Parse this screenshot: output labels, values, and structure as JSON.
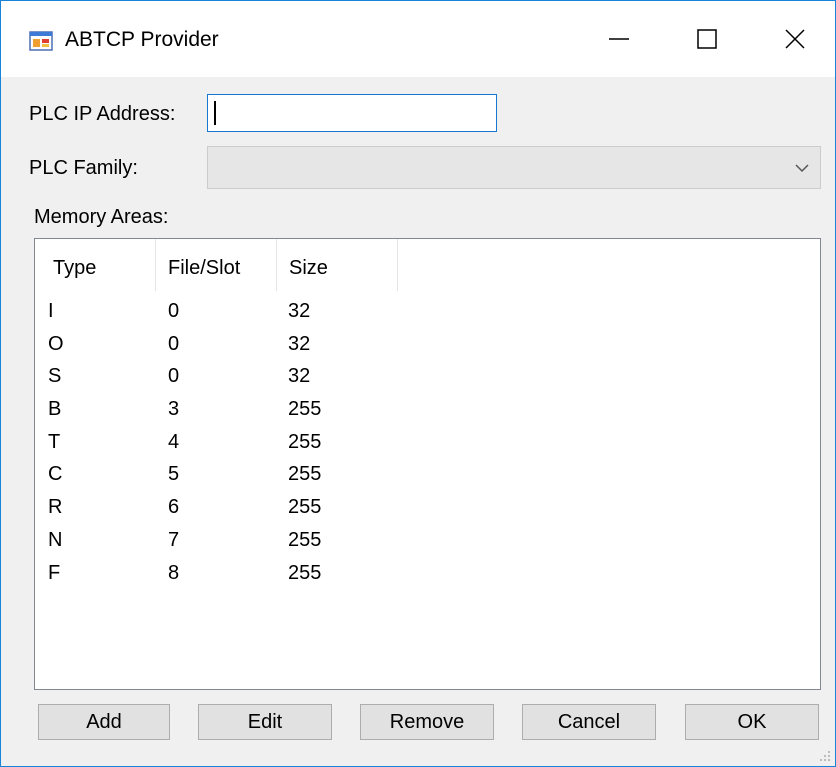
{
  "window": {
    "title": "ABTCP Provider",
    "icon": "app-window-icon",
    "controls": {
      "minimize": "minimize-icon",
      "maximize": "maximize-icon",
      "close": "close-icon"
    },
    "border_color": "#1883d7"
  },
  "form": {
    "ip_label": "PLC IP Address:",
    "ip_value": "",
    "family_label": "PLC Family:",
    "family_value": "",
    "memory_label": "Memory Areas:"
  },
  "memory_table": {
    "columns": [
      "Type",
      "File/Slot",
      "Size"
    ],
    "rows": [
      [
        "I",
        "0",
        "32"
      ],
      [
        "O",
        "0",
        "32"
      ],
      [
        "S",
        "0",
        "32"
      ],
      [
        "B",
        "3",
        "255"
      ],
      [
        "T",
        "4",
        "255"
      ],
      [
        "C",
        "5",
        "255"
      ],
      [
        "R",
        "6",
        "255"
      ],
      [
        "N",
        "7",
        "255"
      ],
      [
        "F",
        "8",
        "255"
      ]
    ]
  },
  "buttons": {
    "add": "Add",
    "edit": "Edit",
    "remove": "Remove",
    "cancel": "Cancel",
    "ok": "OK"
  }
}
